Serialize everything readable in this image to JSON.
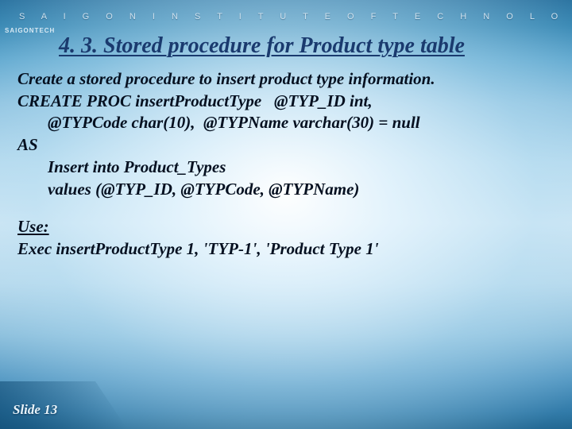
{
  "institution_spaced": "S A I G O N   I N S T I T U T E   O F   T E C H N O L O G Y",
  "logo_text": "SAIGONTECH",
  "title": "4. 3. Stored procedure for Product type table",
  "body": {
    "l1": "Create a stored procedure to insert product type information.",
    "l2": "CREATE PROC insertProductType   @TYP_ID int,",
    "l3": "@TYPCode char(10),  @TYPName varchar(30) = null",
    "l4": "AS",
    "l5": "Insert into Product_Types",
    "l6": "values (@TYP_ID, @TYPCode, @TYPName)",
    "l7": "Use:",
    "l8": "Exec insertProductType 1, 'TYP-1', 'Product Type 1'"
  },
  "footer": "Slide 13"
}
